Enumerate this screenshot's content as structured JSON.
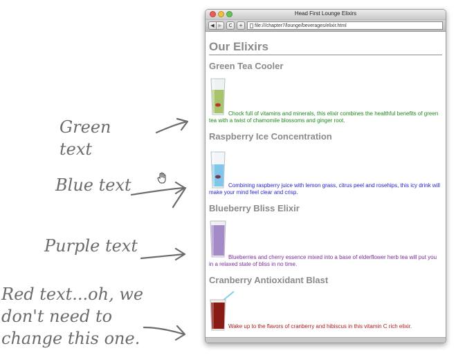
{
  "annotations": {
    "green": "Green\ntext",
    "blue": "Blue text",
    "purple": "Purple text",
    "red": "Red text...oh, we\ndon't need to\nchange this one."
  },
  "window": {
    "title": "Head First Lounge Elixirs",
    "url": "file:///chapter7/lounge/beverages/elixir.html",
    "back_glyph": "◀",
    "forward_glyph": "▶",
    "reload_glyph": "C",
    "add_glyph": "+"
  },
  "page": {
    "heading": "Our Elixirs",
    "elixirs": [
      {
        "name": "Green Tea Cooler",
        "description": "Chock full of vitamins and minerals, this elixir combines the healthful benefits of green tea with a twist of chamomile blossoms and ginger root.",
        "text_color": "#1b8a1b",
        "drink_color": "#a8c46a",
        "annotation": "green"
      },
      {
        "name": "Raspberry Ice Concentration",
        "description": "Combining raspberry juice with lemon grass, citrus peel and rosehips, this icy drink will make your mind feel clear and crisp.",
        "text_color": "#1f1fd6",
        "drink_color": "#7fc6ea",
        "annotation": "blue"
      },
      {
        "name": "Blueberry Bliss Elixir",
        "description": "Blueberries and cherry essence mixed into a base of elderflower herb tea will put you in a relaxed state of bliss in no time.",
        "text_color": "#7a2a9a",
        "drink_color": "#a48ac6",
        "annotation": "purple"
      },
      {
        "name": "Cranberry Antioxidant Blast",
        "description": "Wake up to the flavors of cranberry and hibiscus in this vitamin C rich elixir.",
        "text_color": "#b01818",
        "drink_color": "#8a1a14",
        "annotation": "red"
      }
    ]
  }
}
